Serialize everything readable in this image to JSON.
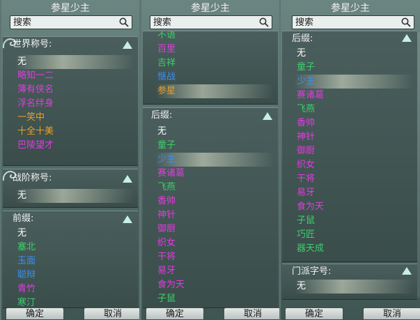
{
  "colors": {
    "white": "#ffffff",
    "magenta": "#e23be0",
    "orange": "#f0a020",
    "green": "#3cd06a",
    "blue": "#3d8ef0"
  },
  "columns": [
    {
      "title": "参星少主",
      "search_placeholder": "搜索",
      "panels": [
        {
          "label": "世界称号:",
          "items": [
            {
              "text": "无",
              "color": "white",
              "selected": true
            },
            {
              "text": "略知一二",
              "color": "magenta"
            },
            {
              "text": "薄有侠名",
              "color": "magenta"
            },
            {
              "text": "浮名绊身",
              "color": "magenta"
            },
            {
              "text": "一笑中",
              "color": "orange"
            },
            {
              "text": "十全十美",
              "color": "orange"
            },
            {
              "text": "巴陵望才",
              "color": "magenta"
            }
          ]
        },
        {
          "label": "战阶称号:",
          "items": [
            {
              "text": "无",
              "color": "white",
              "selected": true
            }
          ]
        },
        {
          "label": "前缀:",
          "items": [
            {
              "text": "无",
              "color": "white"
            },
            {
              "text": "塞北",
              "color": "green"
            },
            {
              "text": "玉面",
              "color": "blue"
            },
            {
              "text": "聪辩",
              "color": "blue"
            },
            {
              "text": "青竹",
              "color": "magenta"
            },
            {
              "text": "寒汀",
              "color": "green"
            }
          ]
        }
      ],
      "confirm": "确定",
      "cancel": "取消"
    },
    {
      "title": "参星少主",
      "search_placeholder": "搜索",
      "panels": [
        {
          "label": "",
          "items": [
            {
              "text": "不语",
              "color": "green"
            },
            {
              "text": "百里",
              "color": "magenta"
            },
            {
              "text": "吉祥",
              "color": "green"
            },
            {
              "text": "惬战",
              "color": "blue"
            },
            {
              "text": "参星",
              "color": "orange",
              "selected": true
            }
          ]
        },
        {
          "label": "后缀:",
          "items": [
            {
              "text": "无",
              "color": "white"
            },
            {
              "text": "童子",
              "color": "green"
            },
            {
              "text": "少主",
              "color": "blue",
              "selected": true
            },
            {
              "text": "赛诸葛",
              "color": "magenta"
            },
            {
              "text": "飞燕",
              "color": "green"
            },
            {
              "text": "香帅",
              "color": "magenta"
            },
            {
              "text": "神针",
              "color": "magenta"
            },
            {
              "text": "御厨",
              "color": "magenta"
            },
            {
              "text": "织女",
              "color": "magenta"
            },
            {
              "text": "干将",
              "color": "magenta"
            },
            {
              "text": "易牙",
              "color": "magenta"
            },
            {
              "text": "食为天",
              "color": "magenta"
            },
            {
              "text": "子鼠",
              "color": "green"
            }
          ]
        }
      ],
      "confirm": "确定",
      "cancel": "取消"
    },
    {
      "title": "参星少主",
      "search_placeholder": "搜索",
      "panels": [
        {
          "label": "后缀:",
          "items": [
            {
              "text": "无",
              "color": "white"
            },
            {
              "text": "童子",
              "color": "green"
            },
            {
              "text": "少主",
              "color": "blue",
              "selected": true
            },
            {
              "text": "赛诸葛",
              "color": "magenta"
            },
            {
              "text": "飞燕",
              "color": "green"
            },
            {
              "text": "香帅",
              "color": "magenta"
            },
            {
              "text": "神针",
              "color": "magenta"
            },
            {
              "text": "御厨",
              "color": "magenta"
            },
            {
              "text": "织女",
              "color": "magenta"
            },
            {
              "text": "干将",
              "color": "magenta"
            },
            {
              "text": "易牙",
              "color": "magenta"
            },
            {
              "text": "食为天",
              "color": "magenta"
            },
            {
              "text": "子鼠",
              "color": "green"
            },
            {
              "text": "巧匠",
              "color": "green"
            },
            {
              "text": "器天成",
              "color": "green"
            }
          ]
        },
        {
          "label": "门派字号:",
          "items": [
            {
              "text": "无",
              "color": "white",
              "selected": true
            }
          ]
        }
      ],
      "confirm": "确定",
      "cancel": "取消"
    }
  ]
}
